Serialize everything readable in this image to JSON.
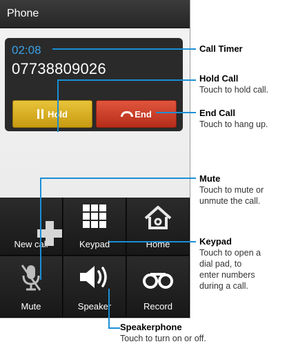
{
  "phone": {
    "app_title": "Phone",
    "call_timer": "02:08",
    "phone_number": "07738809026",
    "hold_label": "Hold",
    "end_label": "End",
    "grid": [
      {
        "label": "New call",
        "icon": "add-call-icon"
      },
      {
        "label": "Keypad",
        "icon": "keypad-icon"
      },
      {
        "label": "Home",
        "icon": "home-icon"
      },
      {
        "label": "Mute",
        "icon": "mute-icon"
      },
      {
        "label": "Speaker",
        "icon": "speaker-icon"
      },
      {
        "label": "Record",
        "icon": "record-icon"
      }
    ]
  },
  "callouts": {
    "call_timer": {
      "title": "Call Timer"
    },
    "hold_call": {
      "title": "Hold Call",
      "desc": "Touch to hold call."
    },
    "end_call": {
      "title": "End Call",
      "desc": "Touch to hang up."
    },
    "mute": {
      "title": "Mute",
      "desc_lines": [
        "Touch to mute or",
        "unmute the call."
      ]
    },
    "keypad": {
      "title": "Keypad",
      "desc_lines": [
        "Touch to open a",
        "dial pad, to",
        "enter numbers",
        "during a call."
      ]
    },
    "speakerphone": {
      "title": "Speakerphone",
      "desc": "Touch to turn on or off."
    }
  },
  "colors": {
    "accent": "#1a8fd6",
    "hold": "#d9ad1f",
    "end": "#cc3f27",
    "timer": "#3ba0e6"
  }
}
